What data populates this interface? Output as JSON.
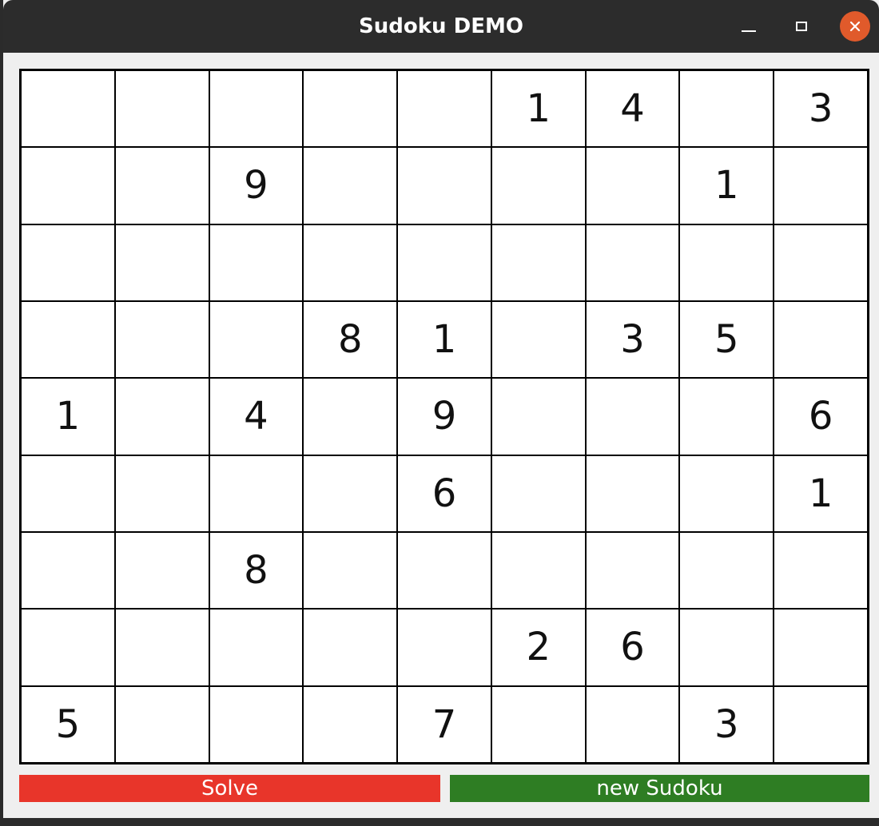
{
  "window": {
    "title": "Sudoku DEMO"
  },
  "titlebar_icons": {
    "minimize": "minimize-icon",
    "maximize": "maximize-icon",
    "close": "close-icon",
    "close_color": "#e05a2b"
  },
  "board": {
    "rows": [
      [
        "",
        "",
        "",
        "",
        "",
        "1",
        "4",
        "",
        "3"
      ],
      [
        "",
        "",
        "9",
        "",
        "",
        "",
        "",
        "1",
        ""
      ],
      [
        "",
        "",
        "",
        "",
        "",
        "",
        "",
        "",
        ""
      ],
      [
        "",
        "",
        "",
        "8",
        "1",
        "",
        "3",
        "5",
        ""
      ],
      [
        "1",
        "",
        "4",
        "",
        "9",
        "",
        "",
        "",
        "6"
      ],
      [
        "",
        "",
        "",
        "",
        "6",
        "",
        "",
        "",
        "1"
      ],
      [
        "",
        "",
        "8",
        "",
        "",
        "",
        "",
        "",
        ""
      ],
      [
        "",
        "",
        "",
        "",
        "",
        "2",
        "6",
        "",
        ""
      ],
      [
        "5",
        "",
        "",
        "",
        "7",
        "",
        "",
        "3",
        ""
      ]
    ]
  },
  "buttons": {
    "solve_label": "Solve",
    "solve_color": "#e8352a",
    "new_label": "new Sudoku",
    "new_color": "#2e7d23"
  }
}
